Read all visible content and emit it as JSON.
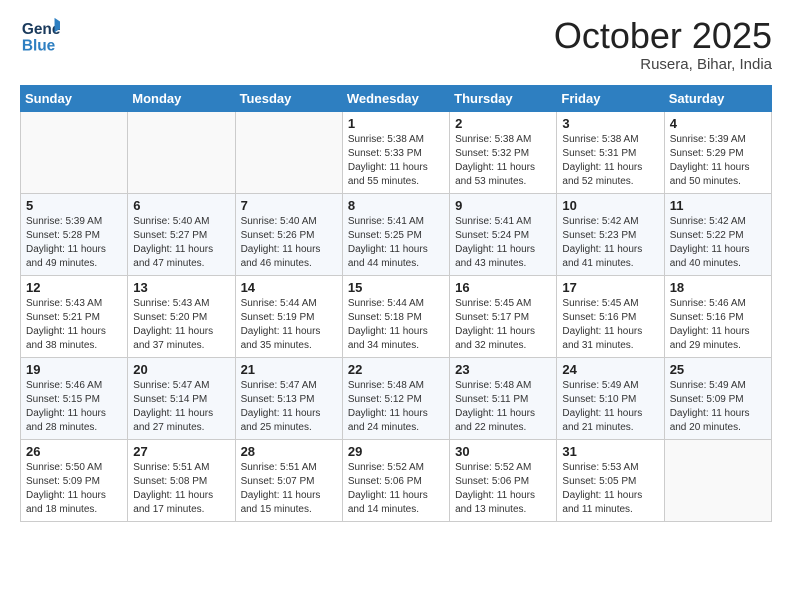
{
  "header": {
    "logo_general": "General",
    "logo_blue": "Blue",
    "month": "October 2025",
    "location": "Rusera, Bihar, India"
  },
  "days_of_week": [
    "Sunday",
    "Monday",
    "Tuesday",
    "Wednesday",
    "Thursday",
    "Friday",
    "Saturday"
  ],
  "weeks": [
    [
      {
        "day": "",
        "info": ""
      },
      {
        "day": "",
        "info": ""
      },
      {
        "day": "",
        "info": ""
      },
      {
        "day": "1",
        "info": "Sunrise: 5:38 AM\nSunset: 5:33 PM\nDaylight: 11 hours\nand 55 minutes."
      },
      {
        "day": "2",
        "info": "Sunrise: 5:38 AM\nSunset: 5:32 PM\nDaylight: 11 hours\nand 53 minutes."
      },
      {
        "day": "3",
        "info": "Sunrise: 5:38 AM\nSunset: 5:31 PM\nDaylight: 11 hours\nand 52 minutes."
      },
      {
        "day": "4",
        "info": "Sunrise: 5:39 AM\nSunset: 5:29 PM\nDaylight: 11 hours\nand 50 minutes."
      }
    ],
    [
      {
        "day": "5",
        "info": "Sunrise: 5:39 AM\nSunset: 5:28 PM\nDaylight: 11 hours\nand 49 minutes."
      },
      {
        "day": "6",
        "info": "Sunrise: 5:40 AM\nSunset: 5:27 PM\nDaylight: 11 hours\nand 47 minutes."
      },
      {
        "day": "7",
        "info": "Sunrise: 5:40 AM\nSunset: 5:26 PM\nDaylight: 11 hours\nand 46 minutes."
      },
      {
        "day": "8",
        "info": "Sunrise: 5:41 AM\nSunset: 5:25 PM\nDaylight: 11 hours\nand 44 minutes."
      },
      {
        "day": "9",
        "info": "Sunrise: 5:41 AM\nSunset: 5:24 PM\nDaylight: 11 hours\nand 43 minutes."
      },
      {
        "day": "10",
        "info": "Sunrise: 5:42 AM\nSunset: 5:23 PM\nDaylight: 11 hours\nand 41 minutes."
      },
      {
        "day": "11",
        "info": "Sunrise: 5:42 AM\nSunset: 5:22 PM\nDaylight: 11 hours\nand 40 minutes."
      }
    ],
    [
      {
        "day": "12",
        "info": "Sunrise: 5:43 AM\nSunset: 5:21 PM\nDaylight: 11 hours\nand 38 minutes."
      },
      {
        "day": "13",
        "info": "Sunrise: 5:43 AM\nSunset: 5:20 PM\nDaylight: 11 hours\nand 37 minutes."
      },
      {
        "day": "14",
        "info": "Sunrise: 5:44 AM\nSunset: 5:19 PM\nDaylight: 11 hours\nand 35 minutes."
      },
      {
        "day": "15",
        "info": "Sunrise: 5:44 AM\nSunset: 5:18 PM\nDaylight: 11 hours\nand 34 minutes."
      },
      {
        "day": "16",
        "info": "Sunrise: 5:45 AM\nSunset: 5:17 PM\nDaylight: 11 hours\nand 32 minutes."
      },
      {
        "day": "17",
        "info": "Sunrise: 5:45 AM\nSunset: 5:16 PM\nDaylight: 11 hours\nand 31 minutes."
      },
      {
        "day": "18",
        "info": "Sunrise: 5:46 AM\nSunset: 5:16 PM\nDaylight: 11 hours\nand 29 minutes."
      }
    ],
    [
      {
        "day": "19",
        "info": "Sunrise: 5:46 AM\nSunset: 5:15 PM\nDaylight: 11 hours\nand 28 minutes."
      },
      {
        "day": "20",
        "info": "Sunrise: 5:47 AM\nSunset: 5:14 PM\nDaylight: 11 hours\nand 27 minutes."
      },
      {
        "day": "21",
        "info": "Sunrise: 5:47 AM\nSunset: 5:13 PM\nDaylight: 11 hours\nand 25 minutes."
      },
      {
        "day": "22",
        "info": "Sunrise: 5:48 AM\nSunset: 5:12 PM\nDaylight: 11 hours\nand 24 minutes."
      },
      {
        "day": "23",
        "info": "Sunrise: 5:48 AM\nSunset: 5:11 PM\nDaylight: 11 hours\nand 22 minutes."
      },
      {
        "day": "24",
        "info": "Sunrise: 5:49 AM\nSunset: 5:10 PM\nDaylight: 11 hours\nand 21 minutes."
      },
      {
        "day": "25",
        "info": "Sunrise: 5:49 AM\nSunset: 5:09 PM\nDaylight: 11 hours\nand 20 minutes."
      }
    ],
    [
      {
        "day": "26",
        "info": "Sunrise: 5:50 AM\nSunset: 5:09 PM\nDaylight: 11 hours\nand 18 minutes."
      },
      {
        "day": "27",
        "info": "Sunrise: 5:51 AM\nSunset: 5:08 PM\nDaylight: 11 hours\nand 17 minutes."
      },
      {
        "day": "28",
        "info": "Sunrise: 5:51 AM\nSunset: 5:07 PM\nDaylight: 11 hours\nand 15 minutes."
      },
      {
        "day": "29",
        "info": "Sunrise: 5:52 AM\nSunset: 5:06 PM\nDaylight: 11 hours\nand 14 minutes."
      },
      {
        "day": "30",
        "info": "Sunrise: 5:52 AM\nSunset: 5:06 PM\nDaylight: 11 hours\nand 13 minutes."
      },
      {
        "day": "31",
        "info": "Sunrise: 5:53 AM\nSunset: 5:05 PM\nDaylight: 11 hours\nand 11 minutes."
      },
      {
        "day": "",
        "info": ""
      }
    ]
  ]
}
